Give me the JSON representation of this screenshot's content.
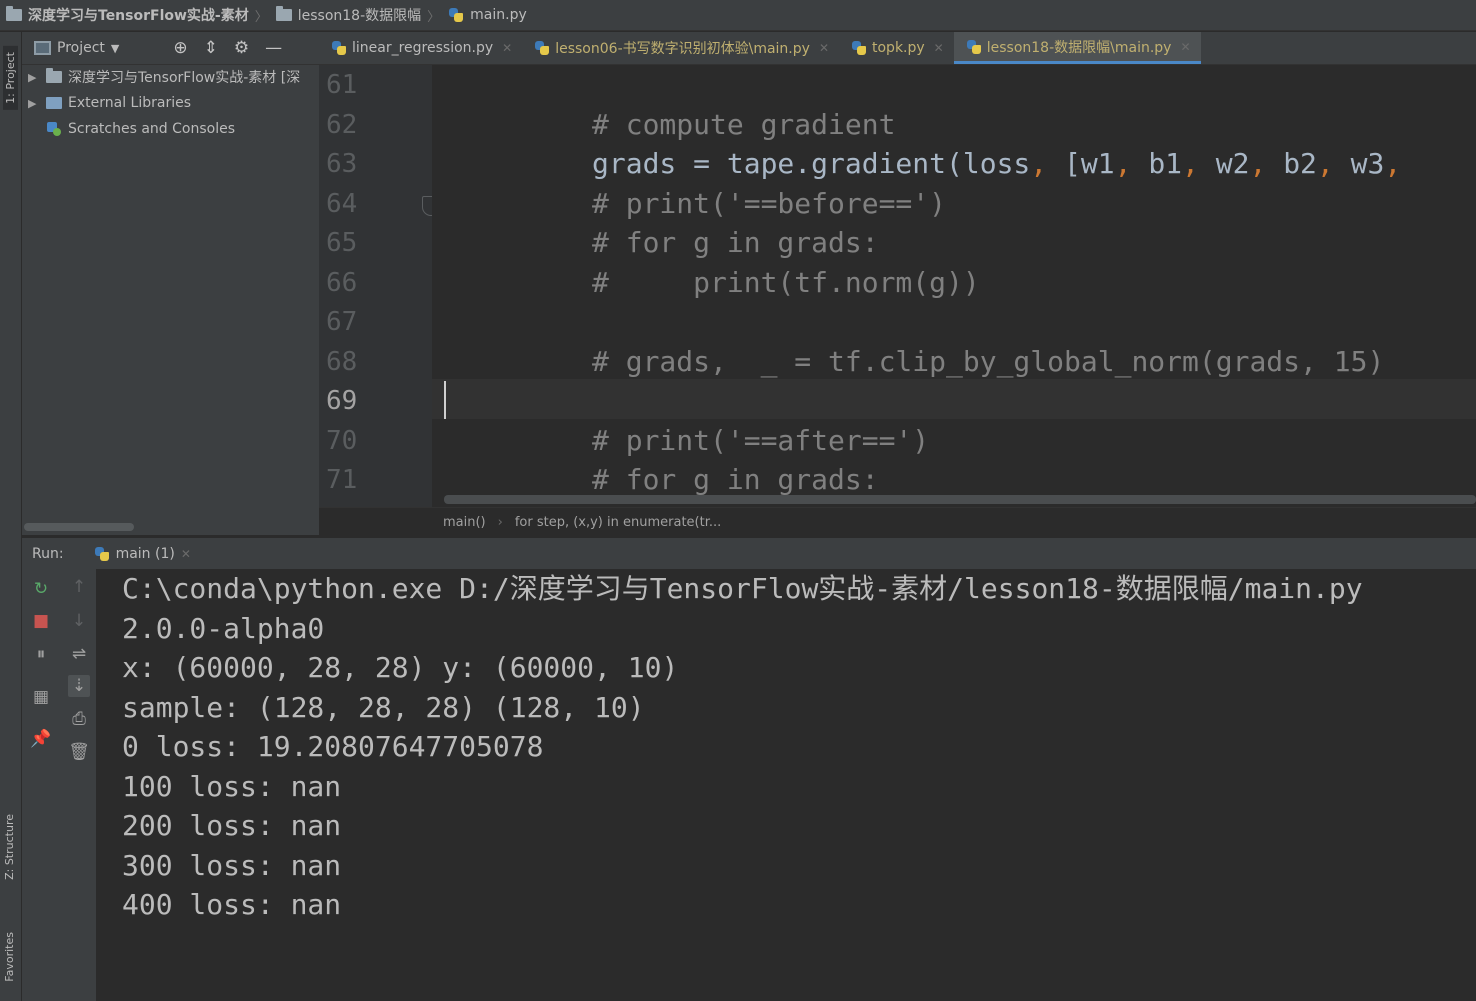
{
  "breadcrumbs": [
    "深度学习与TensorFlow实战-素材",
    "lesson18-数据限幅",
    "main.py"
  ],
  "left_strip": {
    "project_tab": "1: Project",
    "structure_tab": "Z: Structure",
    "favorites_tab": "Favorites"
  },
  "project_toolbar": {
    "title": "Project"
  },
  "editor_tabs": [
    {
      "label": "linear_regression.py"
    },
    {
      "label": "lesson06-书写数字识别初体验\\main.py"
    },
    {
      "label": "topk.py"
    },
    {
      "label": "lesson18-数据限幅\\main.py"
    }
  ],
  "project_tree": [
    {
      "label": "深度学习与TensorFlow实战-素材 [深"
    },
    {
      "label": "External Libraries"
    },
    {
      "label": "Scratches and Consoles"
    }
  ],
  "line_numbers": [
    "61",
    "62",
    "63",
    "64",
    "65",
    "66",
    "67",
    "68",
    "69",
    "70",
    "71"
  ],
  "current_line": "69",
  "code": {
    "l62": "# compute gradient",
    "l63_a": "grads = tape.gradient(loss",
    "l63_b": "[w1",
    "l63_c": "b1",
    "l63_d": "w2",
    "l63_e": "b2",
    "l63_f": "w3",
    "l64": "# print('==before==')",
    "l65": "# for g in grads:",
    "l66": "#     print(tf.norm(g))",
    "l68": "# grads,  _ = tf.clip_by_global_norm(grads, 15)",
    "l70": "# print('==after==')",
    "l71": "# for g in grads:"
  },
  "editor_breadcrumb": [
    "main()",
    "for step, (x,y) in enumerate(tr..."
  ],
  "run_panel": {
    "label": "Run:",
    "tab": "main (1)"
  },
  "console_output": [
    "C:\\conda\\python.exe D:/深度学习与TensorFlow实战-素材/lesson18-数据限幅/main.py",
    "2.0.0-alpha0",
    "x: (60000, 28, 28) y: (60000, 10)",
    "sample: (128, 28, 28) (128, 10)",
    "0 loss: 19.20807647705078",
    "100 loss: nan",
    "200 loss: nan",
    "300 loss: nan",
    "400 loss: nan"
  ],
  "colors": {
    "accent": "#4a88c7",
    "comment": "#808080",
    "keyword": "#cc7832",
    "code_text": "#a9b7c6"
  }
}
